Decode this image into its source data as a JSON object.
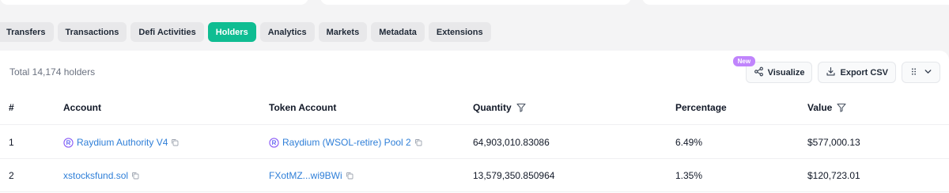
{
  "tabs": [
    {
      "label": "Transfers",
      "active": false
    },
    {
      "label": "Transactions",
      "active": false
    },
    {
      "label": "Defi Activities",
      "active": false
    },
    {
      "label": "Holders",
      "active": true
    },
    {
      "label": "Analytics",
      "active": false
    },
    {
      "label": "Markets",
      "active": false
    },
    {
      "label": "Metadata",
      "active": false
    },
    {
      "label": "Extensions",
      "active": false
    }
  ],
  "holders": {
    "total_label": "Total 14,174 holders",
    "new_badge": "New",
    "visualize_label": "Visualize",
    "export_label": "Export CSV"
  },
  "table": {
    "headers": {
      "num": "#",
      "account": "Account",
      "token_account": "Token Account",
      "quantity": "Quantity",
      "percentage": "Percentage",
      "value": "Value"
    },
    "rows": [
      {
        "num": "1",
        "account": "Raydium Authority V4",
        "token_account": "Raydium (WSOL-retire) Pool 2",
        "quantity": "64,903,010.83086",
        "percentage": "6.49%",
        "value": "$577,000.13"
      },
      {
        "num": "2",
        "account": "xstocksfund.sol",
        "token_account": "FXotMZ...wi9BWi",
        "quantity": "13,579,350.850964",
        "percentage": "1.35%",
        "value": "$120,723.01"
      }
    ]
  },
  "colors": {
    "accent": "#0fbd92",
    "link": "#2f7fd8",
    "badge": "#c084fc"
  },
  "icons": {
    "visualize": "share-nodes-icon",
    "export": "download-icon",
    "columns": "grid-dots-icon",
    "dropdown": "chevron-down-icon",
    "filter": "filter-icon",
    "copy": "copy-icon",
    "protocol": "raydium-icon"
  }
}
